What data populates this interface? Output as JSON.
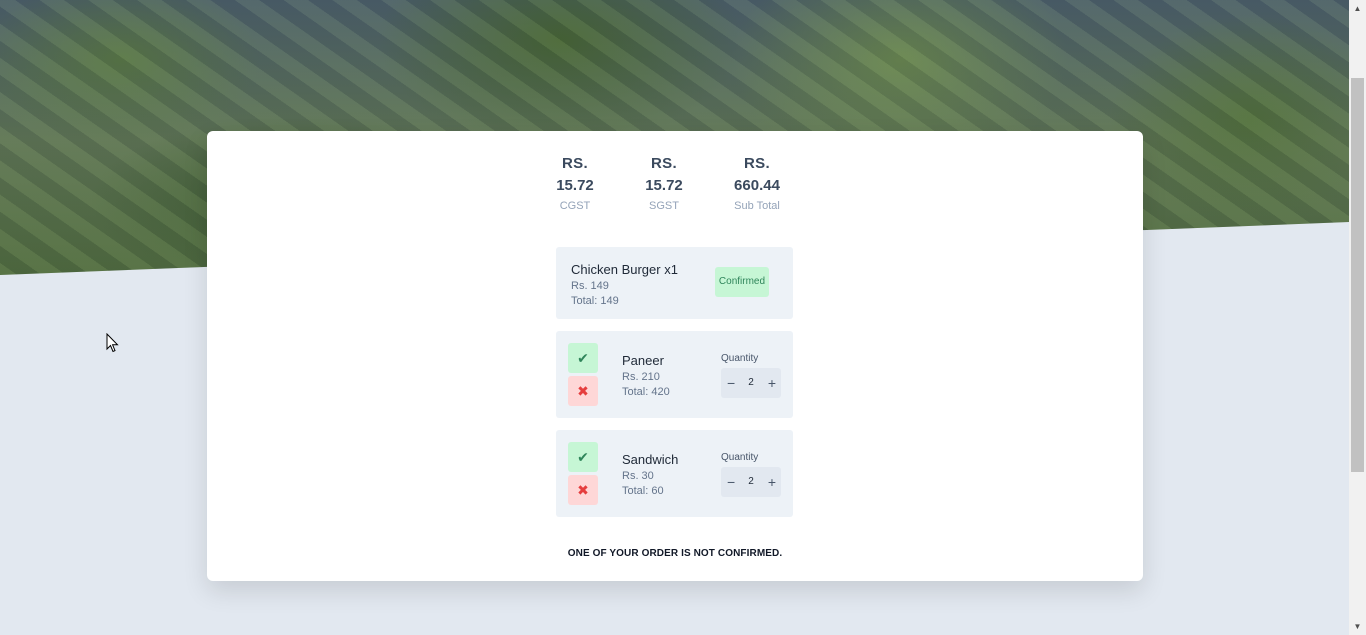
{
  "summary": {
    "cgst": {
      "currency": "RS.",
      "amount": "15.72",
      "label": "CGST"
    },
    "sgst": {
      "currency": "RS.",
      "amount": "15.72",
      "label": "SGST"
    },
    "subtotal": {
      "currency": "RS.",
      "amount": "660.44",
      "label": "Sub Total"
    }
  },
  "items": [
    {
      "name": "Chicken Burger x1",
      "price": "Rs. 149",
      "total": "Total: 149",
      "status": "Confirmed"
    },
    {
      "name": "Paneer",
      "price": "Rs. 210",
      "total": "Total: 420",
      "quantity_label": "Quantity",
      "quantity": "2",
      "minus": "−",
      "plus": "+",
      "accept": "✔",
      "reject": "✖"
    },
    {
      "name": "Sandwich",
      "price": "Rs. 30",
      "total": "Total: 60",
      "quantity_label": "Quantity",
      "quantity": "2",
      "minus": "−",
      "plus": "+",
      "accept": "✔",
      "reject": "✖"
    }
  ],
  "notice": "ONE OF YOUR ORDER IS NOT CONFIRMED.",
  "scrollbar": {
    "up": "▲",
    "down": "▼"
  }
}
